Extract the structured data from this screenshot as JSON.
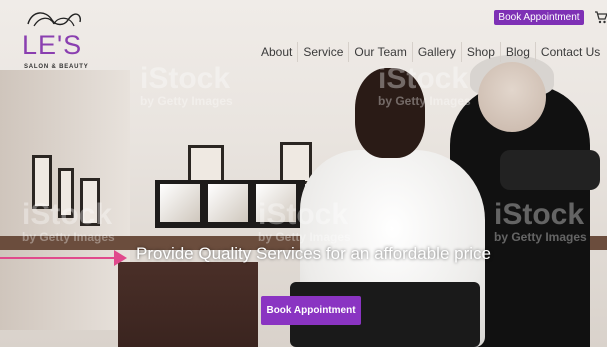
{
  "brand": {
    "logo_text": "LE'S",
    "logo_sub": "SALON & BEAUTY",
    "accent_color": "#7e30b5"
  },
  "header": {
    "book_button": "Book Appointment",
    "cart_icon": "cart-icon"
  },
  "nav": {
    "items": [
      "About",
      "Service",
      "Our Team",
      "Gallery",
      "Shop",
      "Blog",
      "Contact Us"
    ]
  },
  "hero": {
    "tagline": "Provide Quality Services for an affordable price",
    "cta": "Book Appointment",
    "watermark_brand": "iStock",
    "watermark_by": "by Getty Images"
  }
}
